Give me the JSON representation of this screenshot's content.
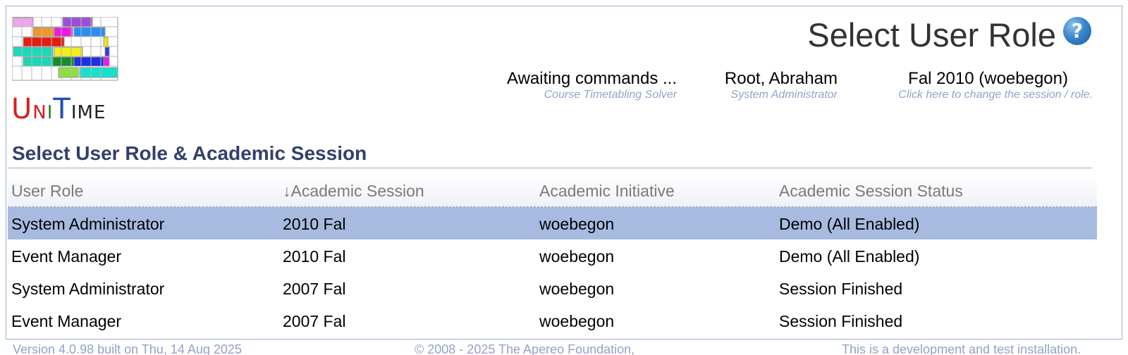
{
  "logo": {
    "text": "UniTime"
  },
  "header": {
    "title": "Select User Role",
    "solver": {
      "status": "Awaiting commands ...",
      "caption": "Course Timetabling Solver"
    },
    "user": {
      "name": "Root, Abraham",
      "role": "System Administrator"
    },
    "session": {
      "name": "Fal 2010 (woebegon)",
      "caption": "Click here to change the session / role."
    }
  },
  "section": {
    "title": "Select User Role & Academic Session"
  },
  "table": {
    "columns": [
      "User Role",
      "↓Academic Session",
      "Academic Initiative",
      "Academic Session Status"
    ],
    "rows": [
      {
        "role": "System Administrator",
        "session": "2010 Fal",
        "initiative": "woebegon",
        "status": "Demo (All Enabled)"
      },
      {
        "role": "Event Manager",
        "session": "2010 Fal",
        "initiative": "woebegon",
        "status": "Demo (All Enabled)"
      },
      {
        "role": "System Administrator",
        "session": "2007 Fal",
        "initiative": "woebegon",
        "status": "Session Finished"
      },
      {
        "role": "Event Manager",
        "session": "2007 Fal",
        "initiative": "woebegon",
        "status": "Session Finished"
      }
    ],
    "selected_row": 0
  },
  "footer": {
    "version": "Version 4.0.98 built on Thu, 14 Aug 2025",
    "copyright": "© 2008 - 2025 The Apereo Foundation,",
    "disclaimer": "This is a development and test installation."
  },
  "icons": {
    "help": "help-icon",
    "logo": "unitime-logo"
  },
  "colors": {
    "selected_row": "#a7bbe0",
    "section_title": "#333f6b",
    "caption": "#8fa4c8",
    "border": "#9cb0ce"
  }
}
